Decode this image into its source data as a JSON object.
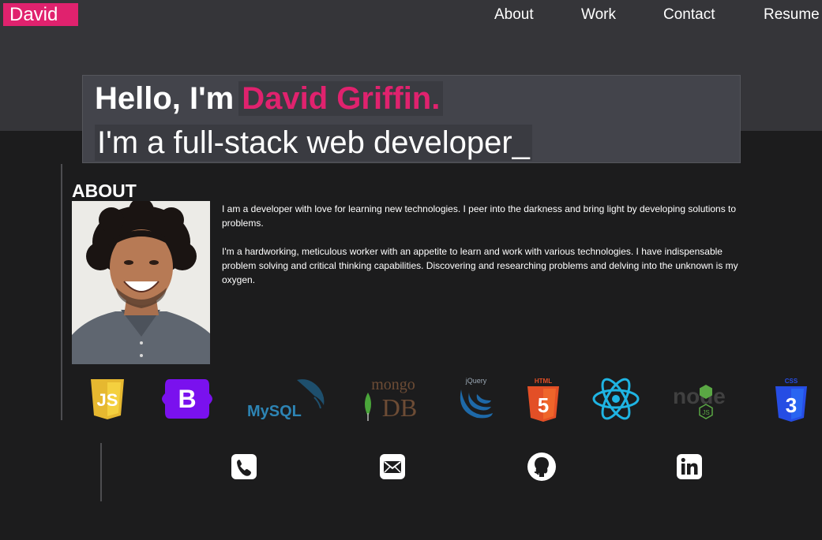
{
  "brand": "David",
  "nav": {
    "about": "About",
    "work": "Work",
    "contact": "Contact",
    "resume": "Resume"
  },
  "hero": {
    "greeting": "Hello, I'm",
    "name": "David Griffin.",
    "tagline": "I'm a full-stack web developer_"
  },
  "about": {
    "title": "ABOUT",
    "paragraph1": "I am a developer with love for learning new technologies. I peer into the darkness and bring light by developing solutions to problems.",
    "paragraph2": "I'm a hardworking, meticulous worker with an appetite to learn and work with various technologies. I have indispensable problem solving and critical thinking capabilities. Discovering and researching problems and delving into the unknown is my oxygen."
  },
  "tech_logos": {
    "javascript": "JS",
    "bootstrap": "B",
    "mysql": "MySQL",
    "mongodb_top": "mongo",
    "mongodb_bottom": "DB",
    "jquery": "jQuery",
    "html5_top": "HTML",
    "html5_num": "5",
    "node": "node",
    "node_js": "JS",
    "css3_top": "CSS",
    "css3_num": "3"
  },
  "colors": {
    "accent": "#e0226e",
    "header_bg": "#353539",
    "page_bg": "#1c1c1d",
    "hero_bg": "#43444b"
  },
  "contact_icons": [
    "phone-icon",
    "email-icon",
    "github-icon",
    "linkedin-icon"
  ]
}
